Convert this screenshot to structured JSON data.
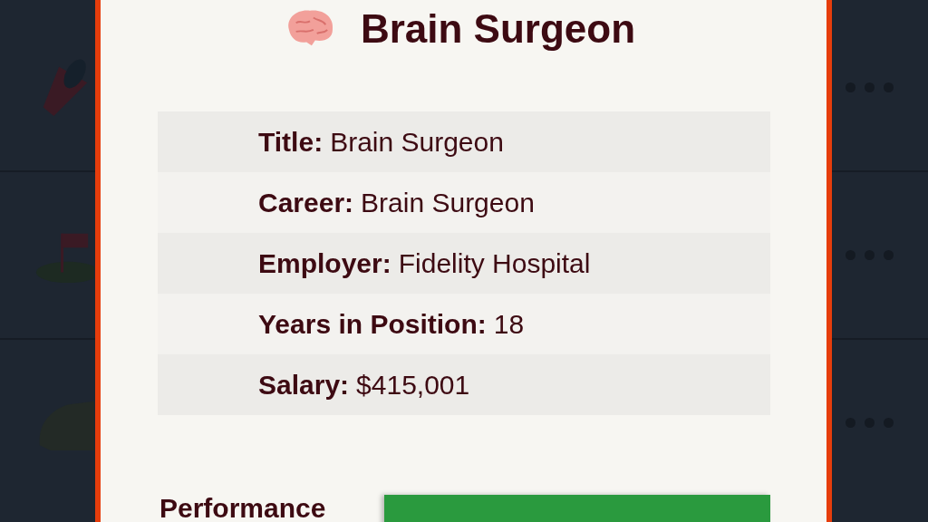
{
  "dialog": {
    "title": "Brain Surgeon",
    "details": [
      {
        "label": "Title:",
        "value": "Brain Surgeon"
      },
      {
        "label": "Career:",
        "value": "Brain Surgeon"
      },
      {
        "label": "Employer:",
        "value": "Fidelity Hospital"
      },
      {
        "label": "Years in Position:",
        "value": "18"
      },
      {
        "label": "Salary:",
        "value": "$415,001"
      }
    ],
    "meters": [
      {
        "label": "Performance"
      }
    ]
  }
}
